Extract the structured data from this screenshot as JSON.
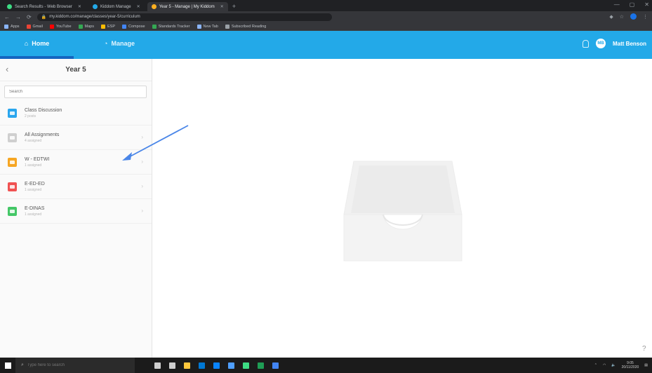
{
  "browser": {
    "tabs": [
      {
        "label": "Search Results - Web Browser",
        "color": "#3ddc84",
        "active": false
      },
      {
        "label": "Kiddom Manage",
        "color": "#23a9e8",
        "active": false
      },
      {
        "label": "Year 5 - Manage | My Kiddom",
        "color": "#ffb020",
        "active": true
      }
    ],
    "url": "my.kiddom.co/manage/classes/year-5/curriculum",
    "bookmarks": [
      {
        "label": "Apps",
        "color": "#8ab4f8"
      },
      {
        "label": "Gmail",
        "color": "#ea4335"
      },
      {
        "label": "YouTube",
        "color": "#ff0000"
      },
      {
        "label": "Maps",
        "color": "#34a853"
      },
      {
        "label": "ESP",
        "color": "#fbbc04"
      },
      {
        "label": "Compose",
        "color": "#4285f4"
      },
      {
        "label": "Standards Tracker",
        "color": "#34a853"
      },
      {
        "label": "New Tab",
        "color": "#8ab4f8"
      },
      {
        "label": "Subscribed Reading",
        "color": "#9aa0a6"
      }
    ]
  },
  "app": {
    "nav": {
      "home_label": "Home",
      "manage_label": "Manage"
    },
    "user": {
      "initials": "MB",
      "name": "Matt Benson"
    }
  },
  "sidebar": {
    "title": "Year 5",
    "search_placeholder": "Search",
    "items": [
      {
        "title": "Class Discussion",
        "subtitle": "2 posts",
        "color": "#2aa6ee"
      },
      {
        "title": "All Assignments",
        "subtitle": "4 assigned",
        "color": "#cfcfcf"
      },
      {
        "title": "W - EDTWI",
        "subtitle": "1 assigned",
        "color": "#f6a623"
      },
      {
        "title": "E-ED-ED",
        "subtitle": "1 assigned",
        "color": "#f05252"
      },
      {
        "title": "E-DINAS",
        "subtitle": "1 assigned",
        "color": "#44c767"
      }
    ]
  },
  "help": {
    "label": "?"
  },
  "taskbar": {
    "search_placeholder": "Type here to search",
    "apps": [
      "#cfcfcf",
      "#cfcfcf",
      "#ffc83d",
      "#0078d4",
      "#0a84ff",
      "#4f9fff",
      "#3ddc84",
      "#1f9d55",
      "#4285f4"
    ],
    "time": "9:05",
    "date": "20/11/2020"
  }
}
